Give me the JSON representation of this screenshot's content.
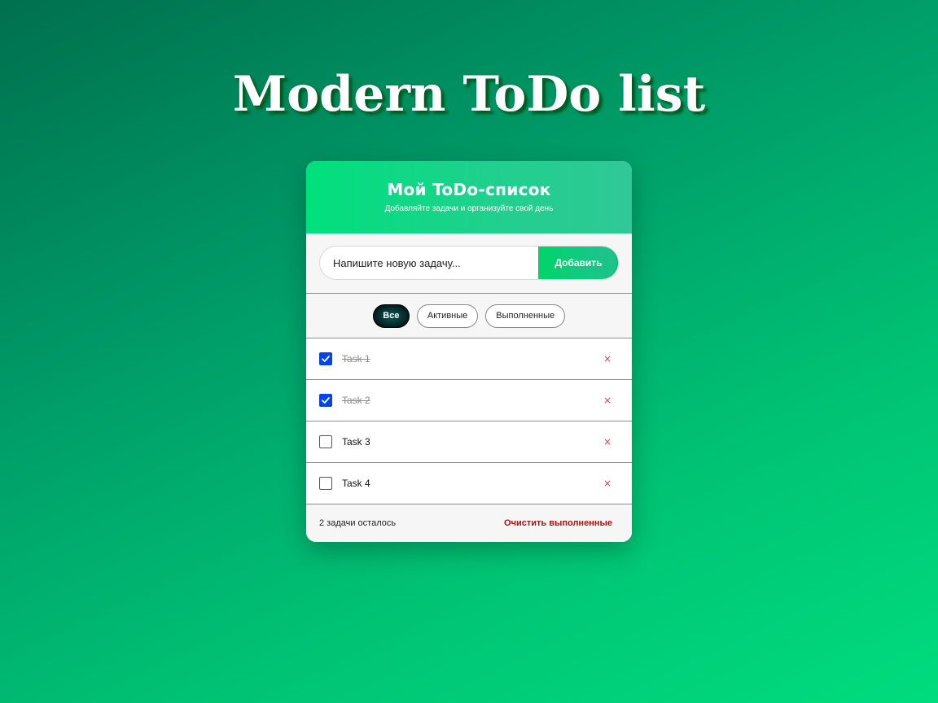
{
  "page": {
    "title": "Modern ToDo list"
  },
  "card": {
    "title": "Мой ToDo-список",
    "subtitle": "Добавляйте задачи и организуйте свой день"
  },
  "input": {
    "placeholder": "Напишите новую задачу...",
    "value": "",
    "add_label": "Добавить"
  },
  "filters": {
    "all": "Все",
    "active": "Активные",
    "completed": "Выполненные",
    "selected": "all"
  },
  "tasks": [
    {
      "text": "Task 1",
      "completed": true,
      "delete_icon": "×"
    },
    {
      "text": "Task 2",
      "completed": true,
      "delete_icon": "×"
    },
    {
      "text": "Task 3",
      "completed": false,
      "delete_icon": "×"
    },
    {
      "text": "Task 4",
      "completed": false,
      "delete_icon": "×"
    }
  ],
  "footer": {
    "remaining": "2 задачи осталось",
    "clear_label": "Очистить выполненные"
  },
  "colors": {
    "accent": "#00e07c",
    "checkbox_checked": "#0044ee",
    "delete": "#e24040",
    "clear": "#b01010"
  }
}
